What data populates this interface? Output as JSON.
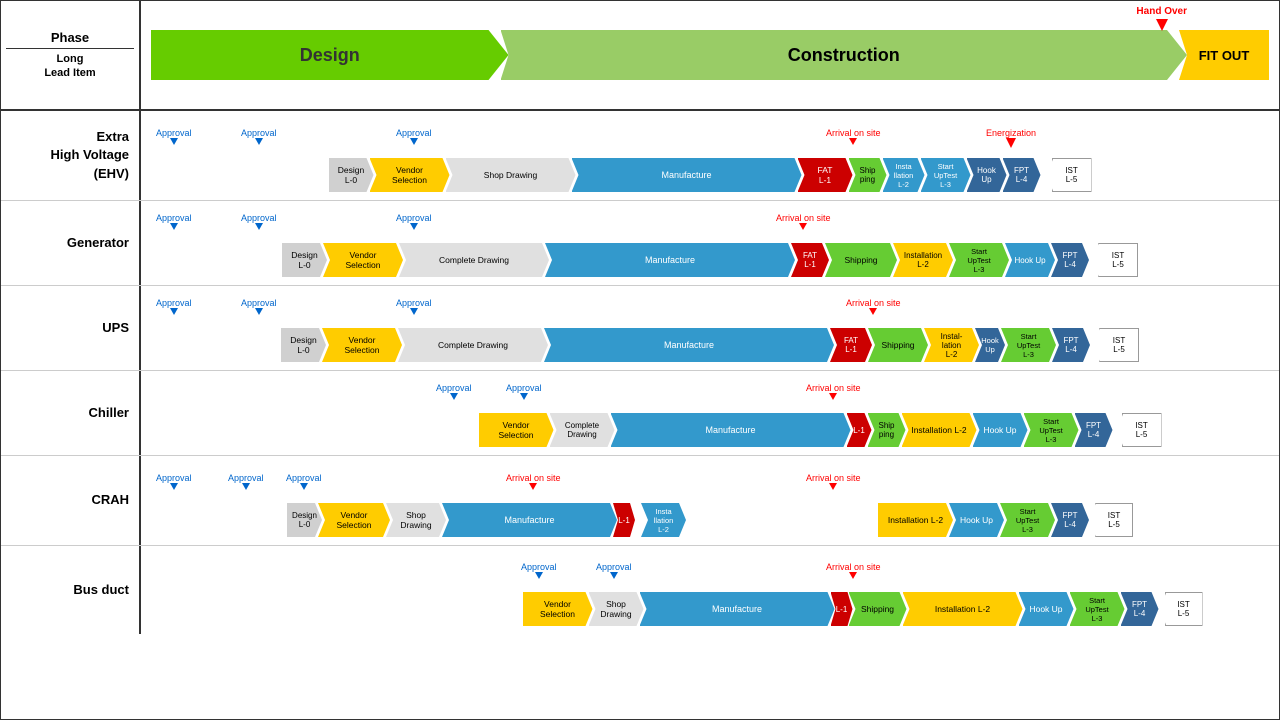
{
  "header": {
    "phase_label": "Phase",
    "long_lead_label": "Long\nLead Item",
    "phases": [
      {
        "label": "Design",
        "color": "#66cc00"
      },
      {
        "label": "Construction",
        "color": "#99cc66"
      },
      {
        "label": "FIT OUT",
        "color": "#ffcc00"
      }
    ],
    "handover": "Hand Over"
  },
  "rows": [
    {
      "label": "Extra\nHigh Voltage\n(EHV)",
      "annotations": [
        "Approval",
        "Approval",
        "Approval",
        "Arrival on site",
        "Energization"
      ],
      "items": [
        "Design L-0",
        "Vendor Selection",
        "Shop Drawing",
        "Manufacture",
        "FAT L-1",
        "Ship ping",
        "Insta llation L-2",
        "Start UpTest L-3",
        "Hook Up",
        "FPT L-4",
        "IST L-5"
      ]
    },
    {
      "label": "Generator",
      "annotations": [
        "Approval",
        "Approval",
        "Approval",
        "Arrival on site"
      ],
      "items": [
        "Design L-0",
        "Vendor Selection",
        "Complete Drawing",
        "Manufacture",
        "FAT L-1",
        "Shipping",
        "Installation L-2",
        "Start UpTest L-3",
        "Hook Up",
        "FPT L-4",
        "IST L-5"
      ]
    },
    {
      "label": "UPS",
      "annotations": [
        "Approval",
        "Approval",
        "Approval",
        "Arrival on site"
      ],
      "items": [
        "Design L-0",
        "Vendor Selection",
        "Complete Drawing",
        "Manufacture",
        "FAT L-1",
        "Shipping",
        "Installation L-2",
        "Hook Up",
        "Start UpTest L-3",
        "FPT L-4",
        "IST L-5"
      ]
    },
    {
      "label": "Chiller",
      "annotations": [
        "Approval",
        "Approval",
        "Arrival on site"
      ],
      "items": [
        "Vendor Selection",
        "Complete Drawing",
        "Manufacture",
        "L-1",
        "Ship ping",
        "Installation L-2",
        "Hook Up",
        "Start UpTest L-3",
        "FPT L-4",
        "IST L-5"
      ]
    },
    {
      "label": "CRAH",
      "annotations": [
        "Approval",
        "Approval",
        "Approval",
        "Arrival on site",
        "Arrival on site"
      ],
      "items": [
        "Design L-0",
        "Vendor Selection",
        "Shop Drawing",
        "Manufacture",
        "L-1",
        "Insta llation L-2",
        "Installation L-2",
        "Hook Up",
        "Start UpTest L-3",
        "FPT L-4",
        "IST L-5"
      ]
    },
    {
      "label": "Bus duct",
      "annotations": [
        "Approval",
        "Approval",
        "Arrival on site"
      ],
      "items": [
        "Vendor Selection",
        "Shop Drawing",
        "Manufacture",
        "L-1",
        "Shipping",
        "Installation L-2",
        "Hook Up",
        "Start UpTest L-3",
        "FPT L-4",
        "IST L-5"
      ]
    }
  ]
}
